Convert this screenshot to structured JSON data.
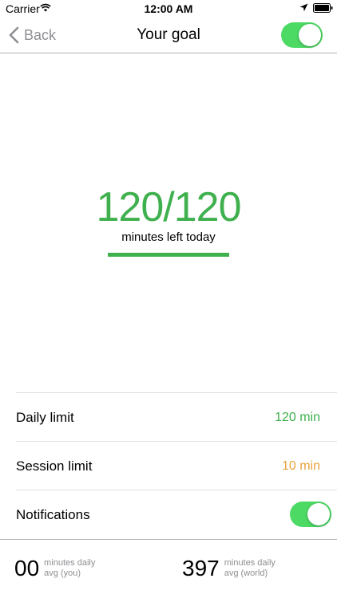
{
  "status_bar": {
    "carrier": "Carrier",
    "time": "12:00 AM",
    "icons": [
      "wifi-icon",
      "location-icon",
      "battery-icon"
    ]
  },
  "nav": {
    "back_label": "Back",
    "title": "Your goal",
    "goal_toggle_on": true
  },
  "hero": {
    "count": "120/120",
    "caption": "minutes left today",
    "progress_fraction": 1.0
  },
  "settings": {
    "daily_limit": {
      "label": "Daily limit",
      "value": "120 min",
      "value_color": "#3fb04e"
    },
    "session_limit": {
      "label": "Session limit",
      "value": "10 min",
      "value_color": "#e8a33d"
    },
    "notifications": {
      "label": "Notifications",
      "enabled": true
    }
  },
  "footer": {
    "you": {
      "number": "00",
      "line1": "minutes daily",
      "line2": "avg (you)"
    },
    "world": {
      "number": "397",
      "line1": "minutes daily",
      "line2": "avg (world)"
    }
  },
  "colors": {
    "accent_green": "#3fb04e",
    "toggle_green": "#4cd964",
    "session_orange": "#e8a33d",
    "muted_gray": "#8e8e93"
  }
}
